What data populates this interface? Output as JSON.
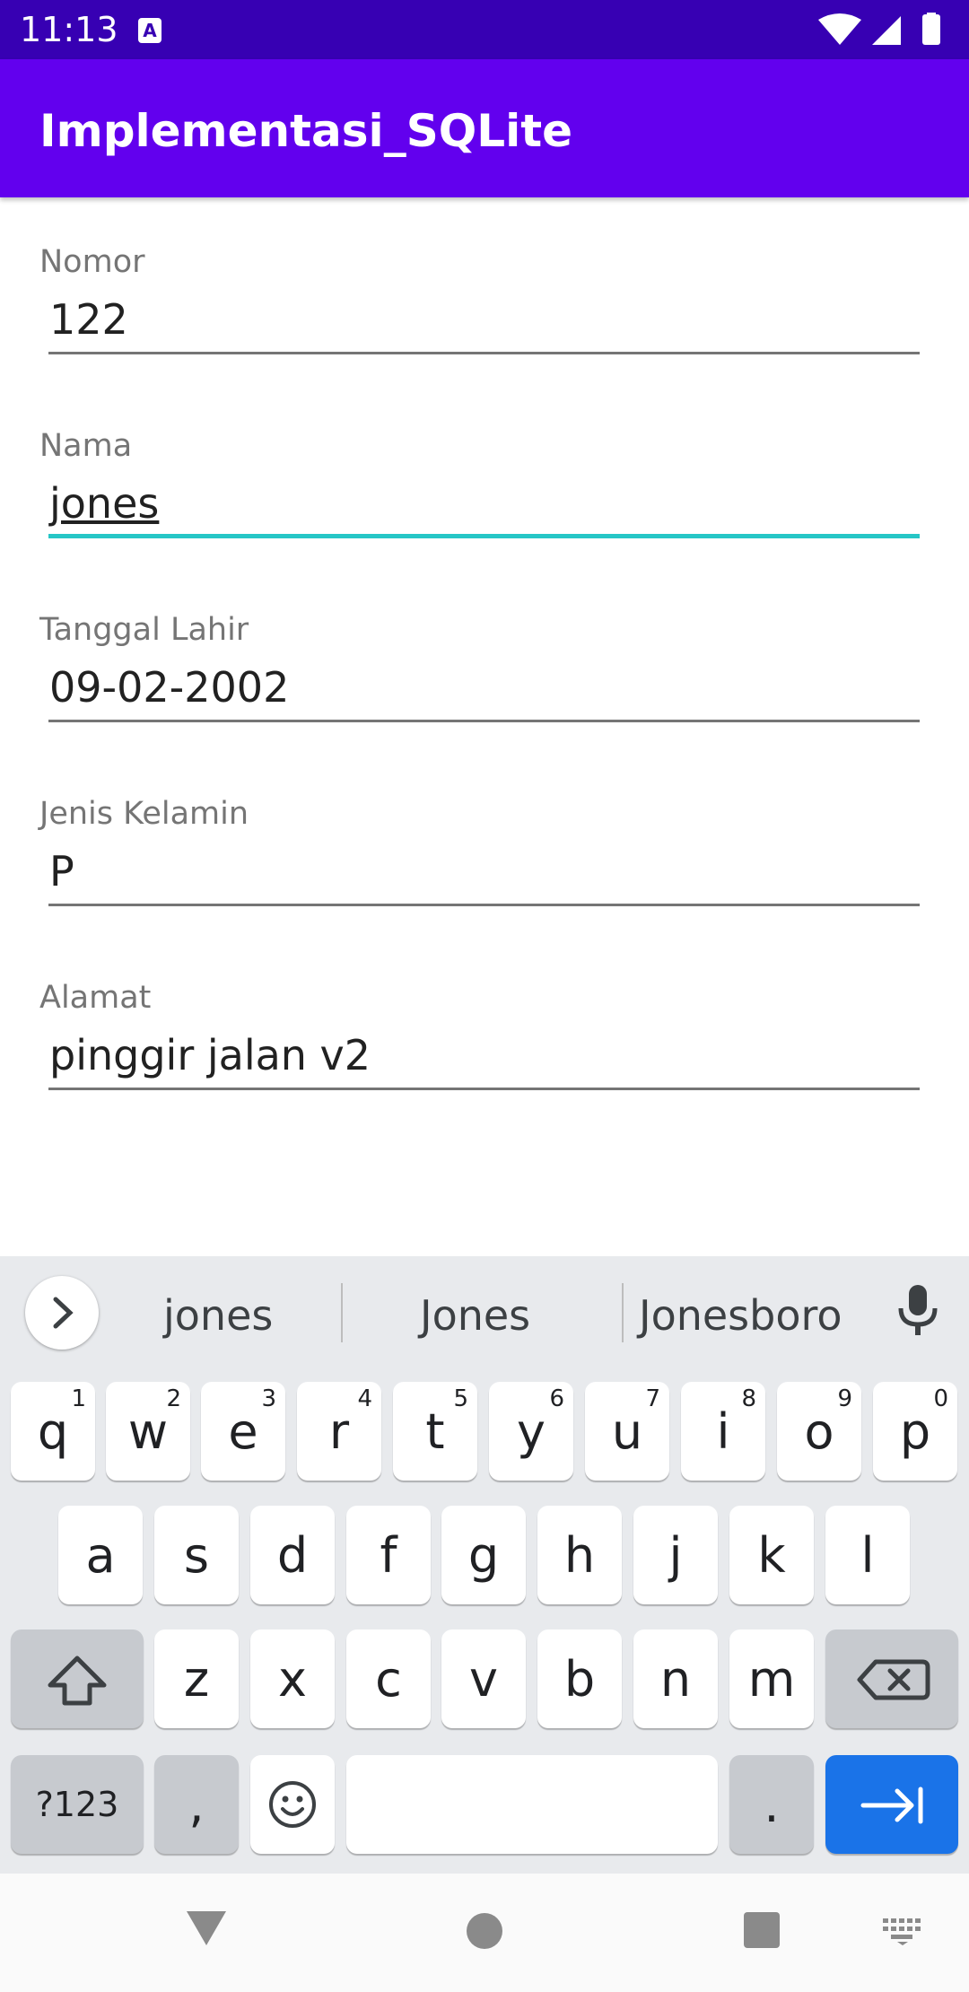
{
  "status_bar": {
    "time": "11:13",
    "notif_icon": "A"
  },
  "app": {
    "title": "Implementasi_SQLite"
  },
  "form": {
    "fields": [
      {
        "label": "Nomor",
        "value": "122"
      },
      {
        "label": "Nama",
        "value": "jones"
      },
      {
        "label": "Tanggal Lahir",
        "value": "09-02-2002"
      },
      {
        "label": "Jenis Kelamin",
        "value": "P"
      },
      {
        "label": "Alamat",
        "value": "pinggir jalan v2"
      }
    ]
  },
  "keyboard": {
    "suggestions": [
      "jones",
      "Jones",
      "Jonesboro"
    ],
    "row1": [
      {
        "k": "q",
        "n": "1"
      },
      {
        "k": "w",
        "n": "2"
      },
      {
        "k": "e",
        "n": "3"
      },
      {
        "k": "r",
        "n": "4"
      },
      {
        "k": "t",
        "n": "5"
      },
      {
        "k": "y",
        "n": "6"
      },
      {
        "k": "u",
        "n": "7"
      },
      {
        "k": "i",
        "n": "8"
      },
      {
        "k": "o",
        "n": "9"
      },
      {
        "k": "p",
        "n": "0"
      }
    ],
    "row2": [
      "a",
      "s",
      "d",
      "f",
      "g",
      "h",
      "j",
      "k",
      "l"
    ],
    "row3": [
      "z",
      "x",
      "c",
      "v",
      "b",
      "n",
      "m"
    ],
    "symbols_label": "?123",
    "comma": ",",
    "period": "."
  },
  "colors": {
    "status_bar": "#3700b3",
    "app_bar": "#6200ee",
    "focus_line": "#26c6c6",
    "enter_key": "#1a73e8"
  }
}
